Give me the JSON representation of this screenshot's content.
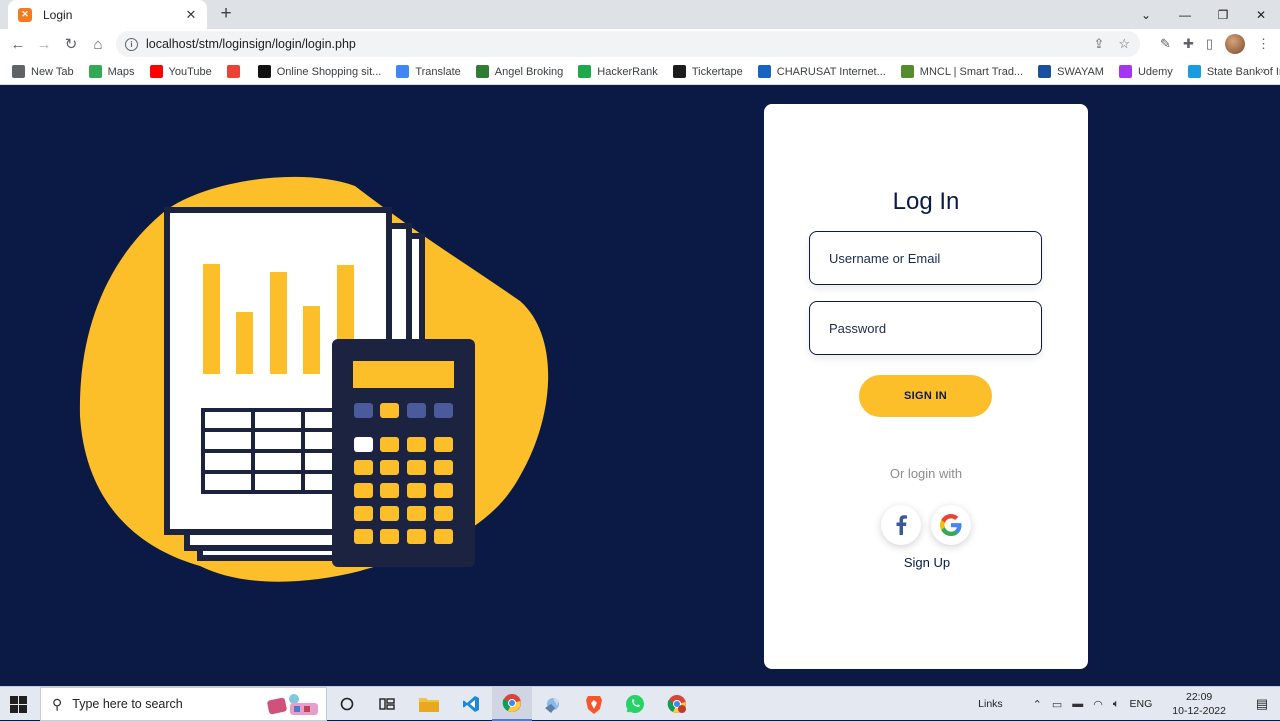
{
  "browser": {
    "tab_title": "Login",
    "url": "localhost/stm/loginsign/login/login.php",
    "bookmarks": [
      {
        "label": "New Tab",
        "icon": "globe-icon",
        "color": "#5f6368"
      },
      {
        "label": "Maps",
        "icon": "maps-icon",
        "color": "#34a853"
      },
      {
        "label": "YouTube",
        "icon": "youtube-icon",
        "color": "#ff0000"
      },
      {
        "label": "",
        "icon": "gmail-icon",
        "color": "#ea4335"
      },
      {
        "label": "Online Shopping sit...",
        "icon": "amazon-icon",
        "color": "#111111"
      },
      {
        "label": "Translate",
        "icon": "translate-icon",
        "color": "#4285f4"
      },
      {
        "label": "Angel Broking",
        "icon": "angel-icon",
        "color": "#2e7d32"
      },
      {
        "label": "HackerRank",
        "icon": "hackerrank-icon",
        "color": "#1ba94c"
      },
      {
        "label": "Tickertape",
        "icon": "tickertape-icon",
        "color": "#1c1c1c"
      },
      {
        "label": "CHARUSAT Internet...",
        "icon": "charusat-icon",
        "color": "#1565c0"
      },
      {
        "label": "MNCL | Smart Trad...",
        "icon": "mncl-icon",
        "color": "#558b2f"
      },
      {
        "label": "SWAYAM",
        "icon": "swayam-icon",
        "color": "#1a4fa0"
      },
      {
        "label": "Udemy",
        "icon": "udemy-icon",
        "color": "#a435f0"
      },
      {
        "label": "State Bank of India",
        "icon": "sbi-icon",
        "color": "#1a9be0"
      }
    ]
  },
  "login": {
    "title": "Log In",
    "username_placeholder": "Username or Email",
    "password_placeholder": "Password",
    "signin_label": "SIGN IN",
    "or_login_with": "Or login with",
    "signup_label": "Sign Up"
  },
  "taskbar": {
    "search_placeholder": "Type here to search",
    "links_label": "Links",
    "language": "ENG",
    "time": "22:09",
    "date": "10-12-2022"
  },
  "colors": {
    "page_background": "#0b1a45",
    "accent_yellow": "#fcbf2a",
    "card_background": "#ffffff"
  }
}
